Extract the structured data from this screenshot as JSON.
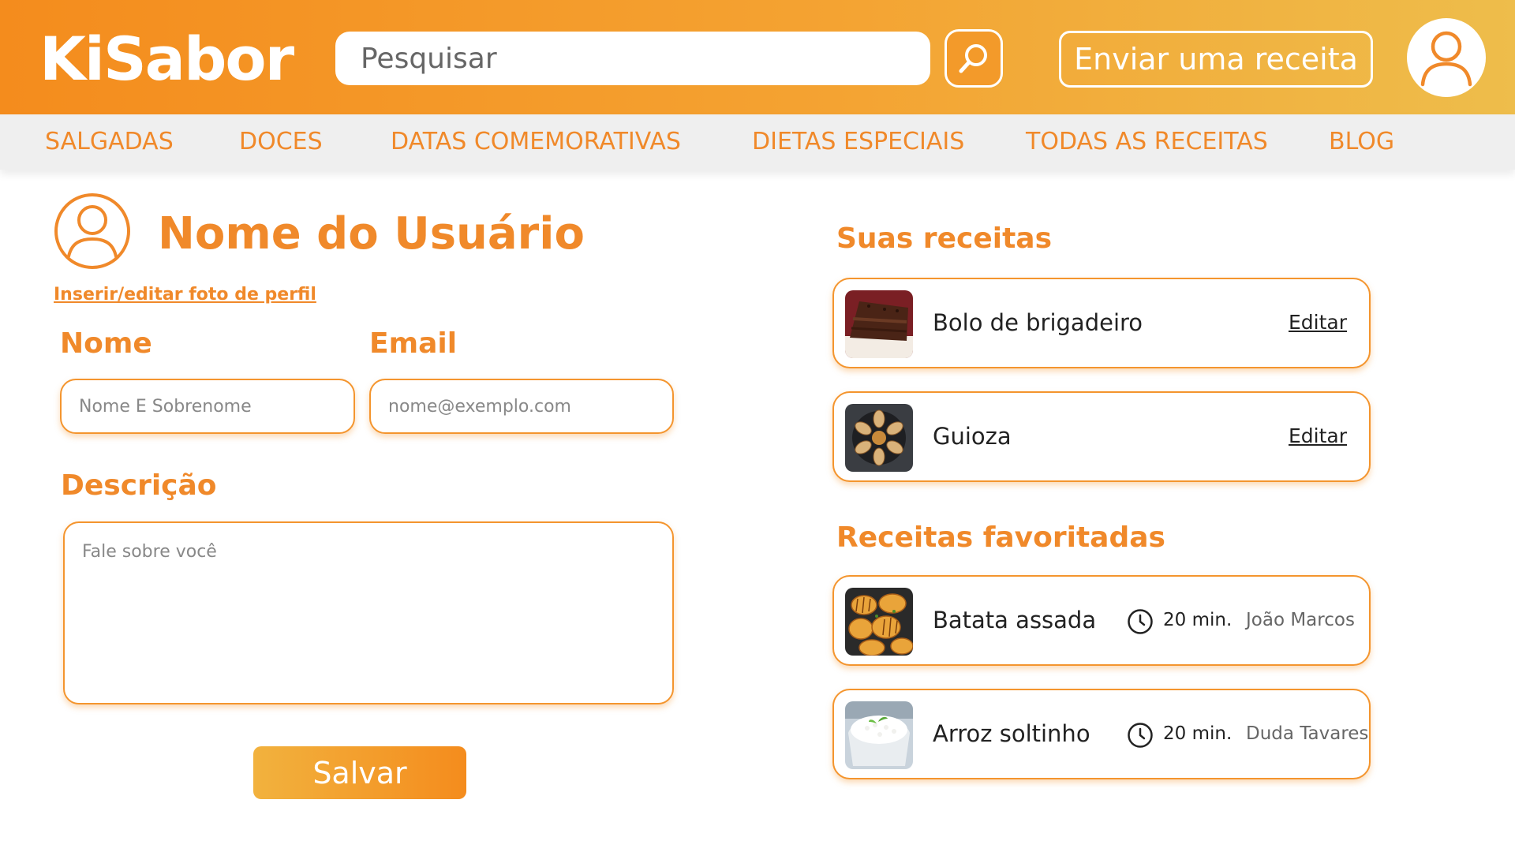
{
  "header": {
    "logo": "KiSabor",
    "search_placeholder": "Pesquisar",
    "send_recipe_label": "Enviar uma receita"
  },
  "nav": {
    "items": [
      "SALGADAS",
      "DOCES",
      "DATAS COMEMORATIVAS",
      "DIETAS ESPECIAIS",
      "TODAS AS RECEITAS",
      "BLOG"
    ]
  },
  "profile": {
    "user_name": "Nome do Usuário",
    "photo_link": "Inserir/editar foto de perfil",
    "name_label": "Nome",
    "name_placeholder": "Nome E Sobrenome",
    "email_label": "Email",
    "email_placeholder": "nome@exemplo.com",
    "description_label": "Descrição",
    "description_placeholder": "Fale sobre você",
    "save_label": "Salvar"
  },
  "my_recipes": {
    "title": "Suas receitas",
    "items": [
      {
        "name": "Bolo de brigadeiro",
        "action": "Editar",
        "thumb": "chocolate-cake"
      },
      {
        "name": "Guioza",
        "action": "Editar",
        "thumb": "dumplings"
      }
    ]
  },
  "favorites": {
    "title": "Receitas favoritadas",
    "items": [
      {
        "name": "Batata assada",
        "time": "20 min.",
        "author": "João Marcos",
        "thumb": "roasted-potatoes"
      },
      {
        "name": "Arroz soltinho",
        "time": "20 min.",
        "author": "Duda Tavares",
        "thumb": "white-rice"
      }
    ]
  },
  "colors": {
    "brand_orange": "#f0892a",
    "header_gradient_start": "#f48c1d",
    "header_gradient_end": "#eebd4b",
    "nav_background": "#efefef"
  },
  "icons": [
    "search-icon",
    "user-icon",
    "clock-icon"
  ]
}
